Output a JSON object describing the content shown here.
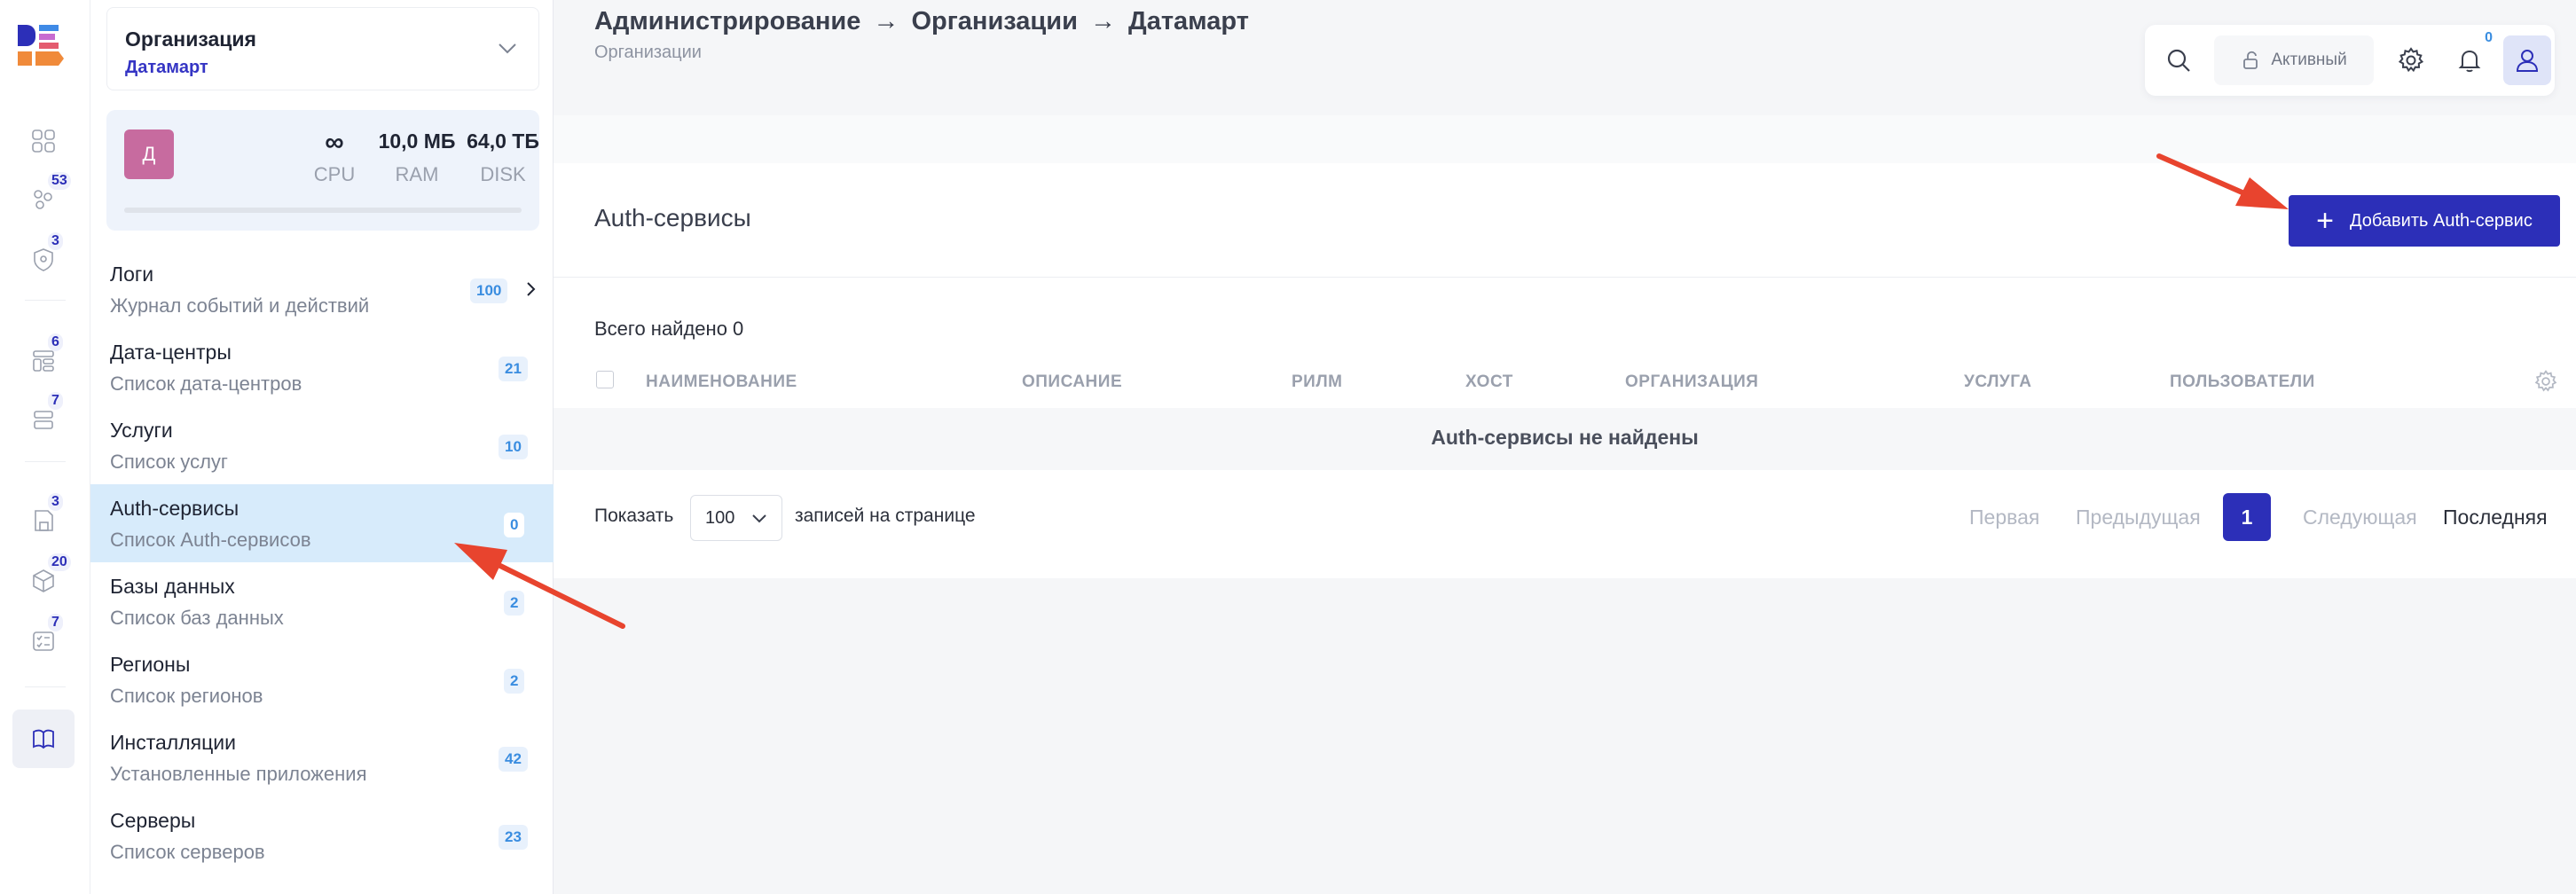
{
  "rail": {
    "badges": {
      "item2": "53",
      "item3": "3",
      "item4": "6",
      "item5": "7",
      "item6": "3",
      "item7": "20",
      "item8": "7"
    }
  },
  "org": {
    "title": "Организация",
    "name": "Датамарт"
  },
  "quota": {
    "avatar_letter": "Д",
    "cpu": {
      "value": "∞",
      "label": "CPU"
    },
    "ram": {
      "value": "10,0 МБ",
      "label": "RAM"
    },
    "disk": {
      "value": "64,0 ТБ",
      "label": "DISK"
    }
  },
  "nav": [
    {
      "title": "Логи",
      "subtitle": "Журнал событий и действий",
      "count": "100"
    },
    {
      "title": "Дата-центры",
      "subtitle": "Список дата-центров",
      "count": "21"
    },
    {
      "title": "Услуги",
      "subtitle": "Список услуг",
      "count": "10"
    },
    {
      "title": "Auth-сервисы",
      "subtitle": "Список Auth-сервисов",
      "count": "0"
    },
    {
      "title": "Базы данных",
      "subtitle": "Список баз данных",
      "count": "2"
    },
    {
      "title": "Регионы",
      "subtitle": "Список регионов",
      "count": "2"
    },
    {
      "title": "Инсталляции",
      "subtitle": "Установленные приложения",
      "count": "42"
    },
    {
      "title": "Серверы",
      "subtitle": "Список серверов",
      "count": "23"
    }
  ],
  "breadcrumb": {
    "items": [
      "Администрирование",
      "Организации",
      "Датамарт"
    ],
    "separator": "→",
    "subtitle": "Организации"
  },
  "toolbar": {
    "status_label": "Активный",
    "notifications_count": "0"
  },
  "page": {
    "title": "Auth-сервисы",
    "add_button": "Добавить Auth-сервис",
    "found_text": "Всего найдено 0",
    "columns": [
      "НАИМЕНОВАНИЕ",
      "ОПИСАНИЕ",
      "РИЛМ",
      "ХОСТ",
      "ОРГАНИЗАЦИЯ",
      "УСЛУГА",
      "ПОЛЬЗОВАТЕЛИ"
    ],
    "empty_text": "Auth-сервисы не найдены"
  },
  "pagination": {
    "show_label": "Показать",
    "per_page": "100",
    "per_page_suffix": "записей на странице",
    "first": "Первая",
    "prev": "Предыдущая",
    "current": "1",
    "next": "Следующая",
    "last": "Последняя"
  },
  "colors": {
    "accent": "#2c2fb8",
    "active_nav": "#d7ebfb",
    "arrow": "#e8442e",
    "avatar": "#c76b9f"
  }
}
